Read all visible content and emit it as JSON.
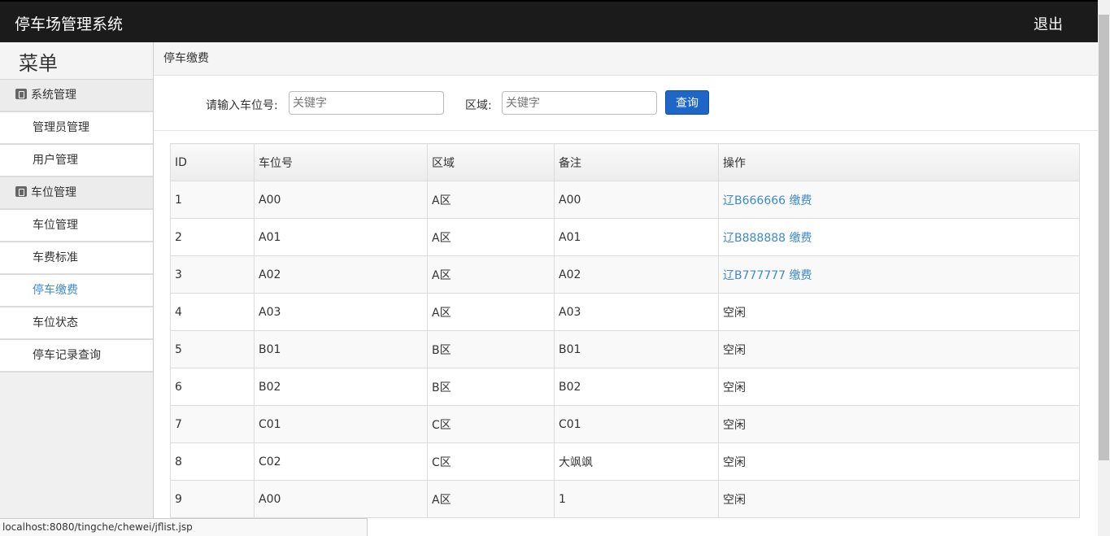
{
  "header": {
    "app_title": "停车场管理系统",
    "logout_label": "退出"
  },
  "sidebar": {
    "menu_title": "菜单",
    "groups": [
      {
        "label": "系统管理",
        "items": [
          "管理员管理",
          "用户管理"
        ]
      },
      {
        "label": "车位管理",
        "items": [
          "车位管理",
          "车费标准",
          "停车缴费",
          "车位状态",
          "停车记录查询"
        ]
      }
    ],
    "active_item": "停车缴费"
  },
  "breadcrumb": "停车缴费",
  "search": {
    "space_label": "请输入车位号:",
    "space_placeholder": "关键字",
    "area_label": "区域:",
    "area_placeholder": "关键字",
    "query_label": "查询"
  },
  "table": {
    "columns": [
      "ID",
      "车位号",
      "区域",
      "备注",
      "操作"
    ],
    "rows": [
      {
        "id": "1",
        "space": "A00",
        "area": "A区",
        "note": "A00",
        "action": "辽B666666 缴费",
        "action_link": true
      },
      {
        "id": "2",
        "space": "A01",
        "area": "A区",
        "note": "A01",
        "action": "辽B888888 缴费",
        "action_link": true
      },
      {
        "id": "3",
        "space": "A02",
        "area": "A区",
        "note": "A02",
        "action": "辽B777777 缴费",
        "action_link": true
      },
      {
        "id": "4",
        "space": "A03",
        "area": "A区",
        "note": "A03",
        "action": "空闲",
        "action_link": false
      },
      {
        "id": "5",
        "space": "B01",
        "area": "B区",
        "note": "B01",
        "action": "空闲",
        "action_link": false
      },
      {
        "id": "6",
        "space": "B02",
        "area": "B区",
        "note": "B02",
        "action": "空闲",
        "action_link": false
      },
      {
        "id": "7",
        "space": "C01",
        "area": "C区",
        "note": "C01",
        "action": "空闲",
        "action_link": false
      },
      {
        "id": "8",
        "space": "C02",
        "area": "C区",
        "note": "大飒飒",
        "action": "空闲",
        "action_link": false
      },
      {
        "id": "9",
        "space": "A00",
        "area": "A区",
        "note": "1",
        "action": "空闲",
        "action_link": false
      }
    ]
  },
  "status_bar": "localhost:8080/tingche/chewei/jflist.jsp",
  "colors": {
    "topbar": "#1b1b1b",
    "link": "#3e8acb",
    "button": "#1e66c8"
  }
}
